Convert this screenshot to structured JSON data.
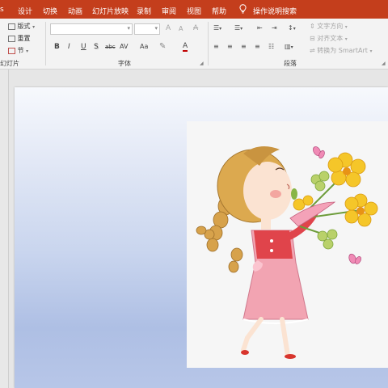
{
  "ribbon_tabs": [
    "设计",
    "切换",
    "动画",
    "幻灯片放映",
    "录制",
    "审阅",
    "视图",
    "帮助"
  ],
  "tell_me": {
    "icon": "lightbulb-icon",
    "label": "操作说明搜索"
  },
  "slides_group": {
    "layout_label": "版式",
    "reset_label": "重置",
    "section_label": "节",
    "group_name": "幻灯片"
  },
  "font_group": {
    "font_name_value": "",
    "font_size_value": "",
    "grow_font": "A",
    "shrink_font": "A",
    "clear_format": "A",
    "bold": "B",
    "italic": "I",
    "underline": "U",
    "shadow": "S",
    "strikethrough": "abc",
    "char_spacing": "AV",
    "change_case": "Aa",
    "font_color": "A",
    "group_name": "字体"
  },
  "paragraph_group": {
    "text_direction": "文字方向",
    "align_text": "对齐文本",
    "convert_smartart": "转换为 SmartArt",
    "group_name": "段落"
  },
  "colors": {
    "accent": "#c43e1c",
    "ribbon_bg": "#f3f3f3"
  }
}
